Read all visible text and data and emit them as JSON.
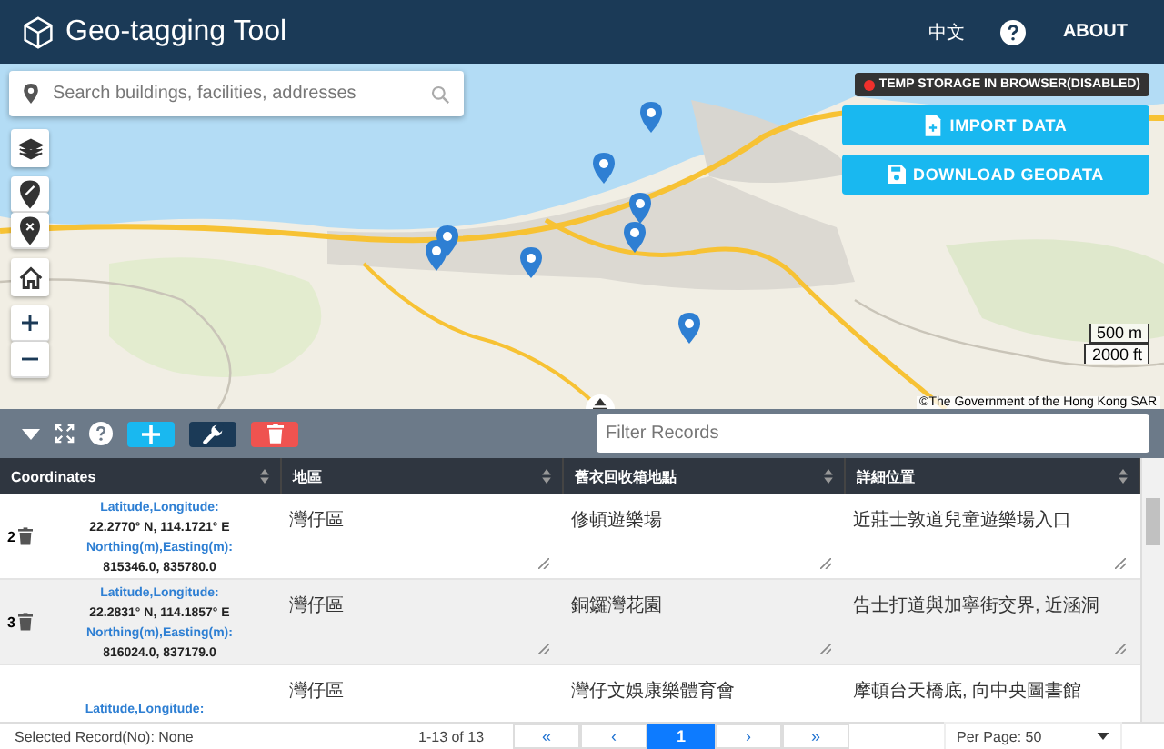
{
  "header": {
    "title": "Geo-tagging Tool",
    "language": "中文",
    "about": "ABOUT"
  },
  "map": {
    "search": {
      "placeholder": "Search buildings, facilities, addresses"
    },
    "storage": {
      "label": "TEMP STORAGE IN BROWSER(DISABLED)",
      "enabled": false
    },
    "actions": [
      "IMPORT DATA",
      "DOWNLOAD GEODATA"
    ],
    "scale": [
      "500 m",
      "2000 ft"
    ],
    "attribution": "©The Government of the Hong Kong SAR"
  },
  "toolbar": {
    "filter": {
      "placeholder": "Filter Records"
    }
  },
  "table": {
    "columns": [
      "Coordinates",
      "地區",
      "舊衣回收箱地點",
      "詳細位置"
    ],
    "rows": [
      {
        "number": "2",
        "latlng_label": "Latitude,Longitude:",
        "latlng": "22.2770° N, 114.1721° E",
        "grid_label": "Northing(m),Easting(m):",
        "grid": "815346.0, 835780.0",
        "district": "灣仔區",
        "location": "修頓遊樂場",
        "detail": "近莊士敦道兒童遊樂場入口"
      },
      {
        "number": "3",
        "latlng_label": "Latitude,Longitude:",
        "latlng": "22.2831° N, 114.1857° E",
        "grid_label": "Northing(m),Easting(m):",
        "grid": "816024.0, 837179.0",
        "district": "灣仔區",
        "location": "銅鑼灣花園",
        "detail": "告士打道與加寧街交界, 近涵洞"
      },
      {
        "latlng_label": "Latitude,Longitude:",
        "district": "灣仔區",
        "location": "灣仔文娛康樂體育會",
        "detail": "摩頓台天橋底, 向中央圖書館"
      }
    ]
  },
  "footer": {
    "selected": "Selected Record(No): None",
    "range": "1-13 of 13",
    "pages": [
      {
        "label": "«",
        "selected": false
      },
      {
        "label": "‹",
        "selected": false
      },
      {
        "label": "1",
        "selected": true
      },
      {
        "label": "›",
        "selected": false
      },
      {
        "label": "»",
        "selected": false
      }
    ],
    "per_page": "Per Page: 50"
  }
}
